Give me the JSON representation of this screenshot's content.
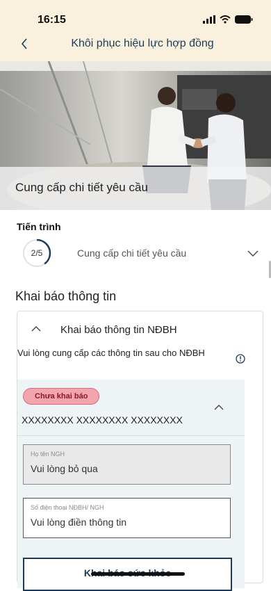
{
  "status_bar": {
    "time": "16:15"
  },
  "header": {
    "title": "Khôi phục hiệu lực hợp đồng"
  },
  "hero": {
    "caption": "Cung cấp chi tiết yêu cầu"
  },
  "progress": {
    "label": "Tiến trình",
    "step_text": "2/5",
    "current_step": 2,
    "total_steps": 5,
    "step_name": "Cung cấp chi tiết yêu cầu"
  },
  "section": {
    "title": "Khai báo thông tin"
  },
  "card": {
    "title": "Khai báo thông tin NĐBH",
    "description": "Vui lòng cung cấp các thông tin sau cho NĐBH",
    "insured": {
      "badge": "Chưa khai báo",
      "name": "XXXXXXXX XXXXXXXX XXXXXXXX",
      "fields": [
        {
          "label": "Họ tên NGH",
          "value": "Vui lòng bỏ qua"
        },
        {
          "label": "Số điện thoại NĐBH/ NGH",
          "placeholder": "Vui lòng điền thông tin"
        }
      ],
      "health_button": "Khai báo sức khỏe"
    }
  },
  "colors": {
    "header_bg": "#f9f1de",
    "primary": "#1d3b58",
    "badge_bg": "#f4a4ad",
    "badge_text": "#8a1826",
    "progress_ring": "#1d3b58"
  },
  "icons": [
    "back-chevron",
    "signal",
    "wifi",
    "battery",
    "chevron-down",
    "chevron-up",
    "info"
  ]
}
